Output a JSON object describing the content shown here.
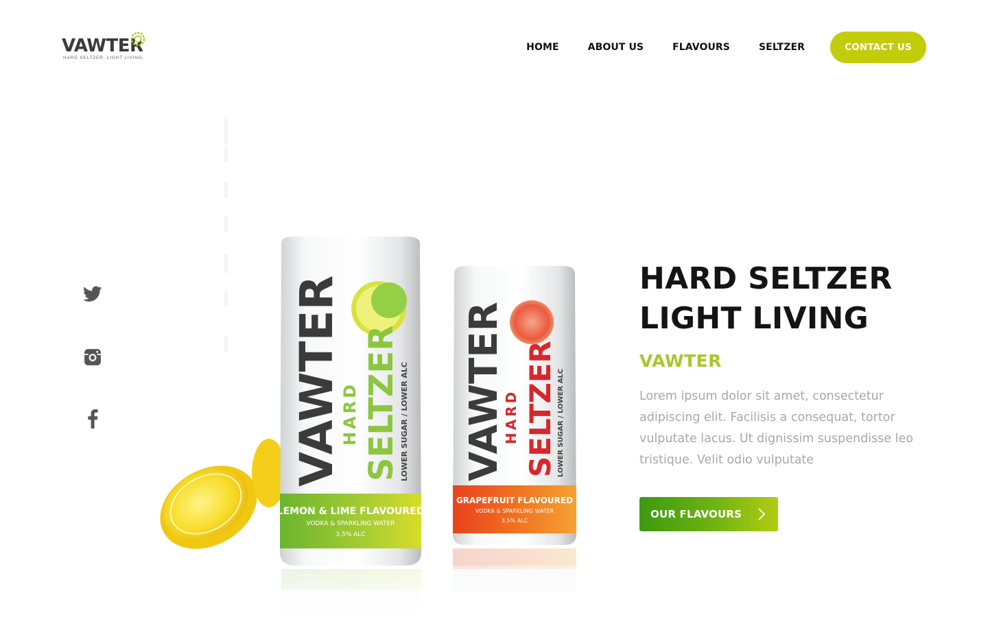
{
  "logo": {
    "wordmark": "VAWTER",
    "tagline": "HARD SELTZER. LIGHT LIVING.",
    "accent": "#a6c82b"
  },
  "nav": {
    "items": [
      "HOME",
      "ABOUT US",
      "FLAVOURS",
      "SELTZER"
    ],
    "cta": "CONTACT US",
    "cta_color": "#c3cc0a"
  },
  "social": [
    {
      "icon": "twitter-icon"
    },
    {
      "icon": "instagram-icon"
    },
    {
      "icon": "facebook-icon"
    }
  ],
  "watermark": "VAWTER",
  "product": {
    "can1": {
      "brand": "VAWTER",
      "type": "HARD",
      "name": "SELTZER",
      "side": "LOWER SUGAR / LOWER ALC",
      "flavour": "LEMON & LIME FLAVOURED",
      "sub": "VODKA & SPARKLING WATER",
      "abv": "3.5% ALC",
      "color": "#8cc63f"
    },
    "can2": {
      "brand": "VAWTER",
      "type": "HARD",
      "name": "SELTZER",
      "side": "LOWER SUGAR / LOWER ALC",
      "flavour": "GRAPEFRUIT FLAVOURED",
      "sub": "VODKA & SPARKLING WATER",
      "abv": "3.5% ALC",
      "color": "#d9262b"
    }
  },
  "hero": {
    "title_line1": "HARD SELTZER",
    "title_line2": "LIGHT LIVING",
    "brand": "VAWTER",
    "description": "Lorem ipsum dolor sit amet, consectetur adipiscing elit. Facilisis a consequat, tortor vulputate lacus. Ut dignissim suspendisse leo tristique. Velit odio vulputate",
    "cta": "OUR FLAVOURS"
  }
}
